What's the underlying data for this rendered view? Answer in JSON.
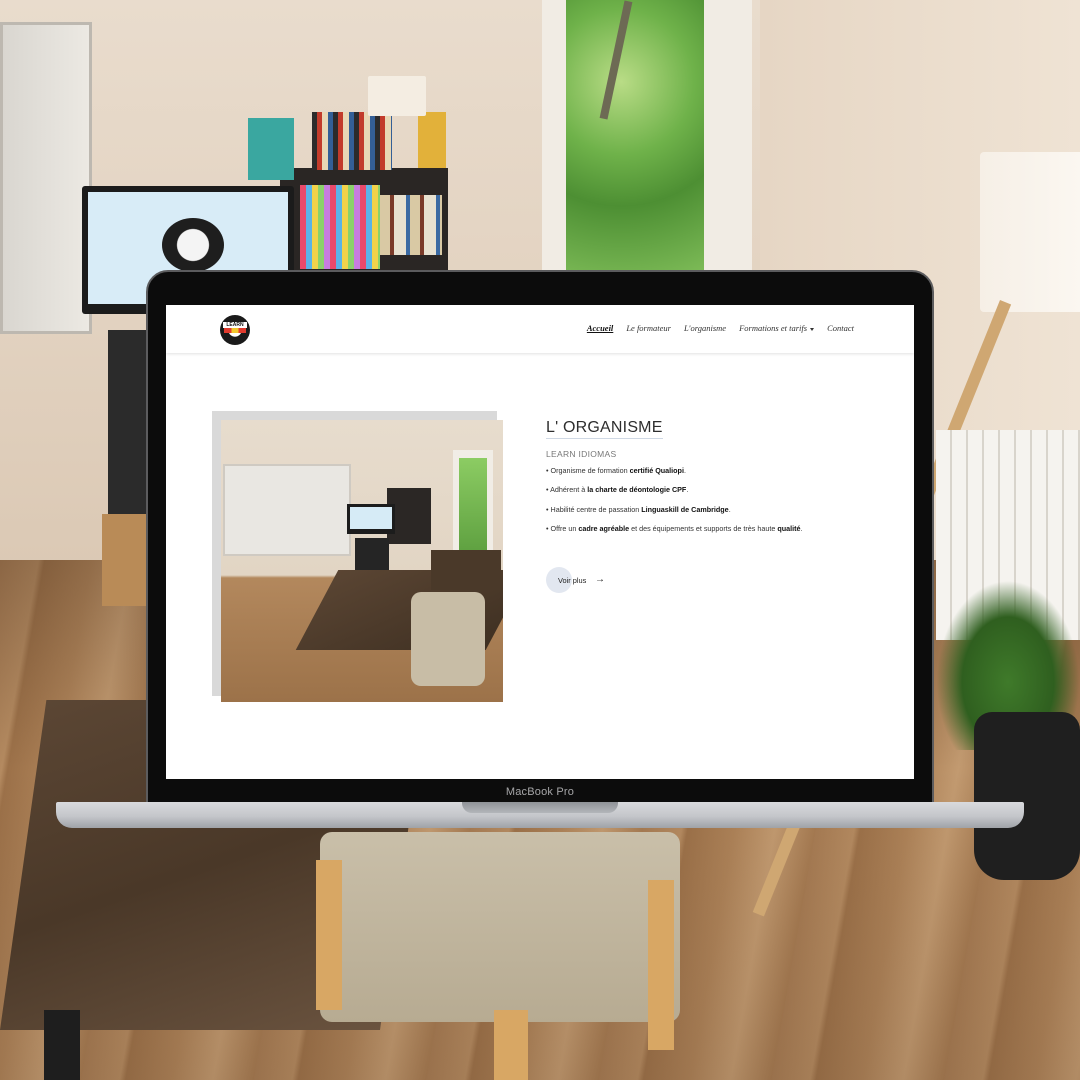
{
  "device": {
    "label": "MacBook Pro"
  },
  "nav": {
    "logo_text": "LEARN",
    "links": [
      {
        "label": "Accueil",
        "active": true
      },
      {
        "label": "Le formateur"
      },
      {
        "label": "L'organisme"
      },
      {
        "label": "Formations et tarifs",
        "dropdown": true
      },
      {
        "label": "Contact"
      }
    ]
  },
  "main": {
    "heading": "L' ORGANISME",
    "subheading": "LEARN IDIOMAS",
    "bullets": [
      {
        "parts": [
          "• Organisme de formation ",
          "certifié Qualiopi",
          "."
        ]
      },
      {
        "parts": [
          "• Adhérent à ",
          "la charte de déontologie CPF",
          "."
        ]
      },
      {
        "parts": [
          "• Habilité centre de passation ",
          "Linguaskill de Cambridge",
          "."
        ]
      },
      {
        "parts": [
          "• Offre un ",
          "cadre agréable",
          " et des équipements et supports de très haute ",
          "qualité",
          "."
        ]
      }
    ],
    "cta_label": "Voir plus",
    "cta_arrow": "→"
  },
  "colors": {
    "accent_circle": "#e2e7f0",
    "bezel": "#0c0c0c",
    "page_bg": "#ffffff"
  }
}
